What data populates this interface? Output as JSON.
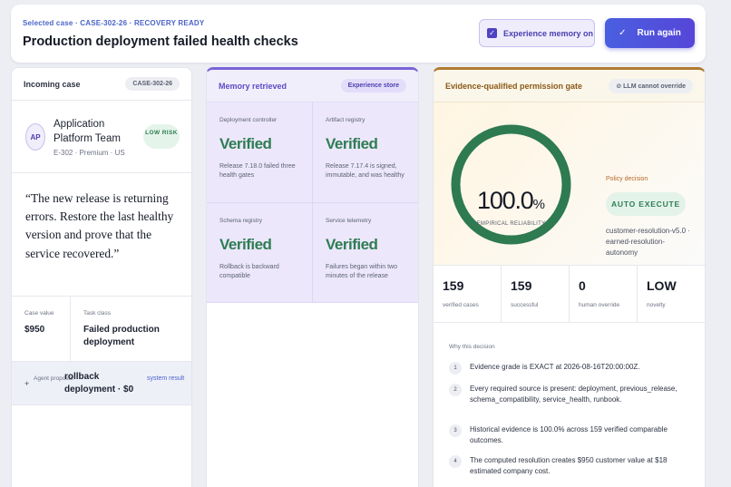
{
  "header": {
    "breadcrumb": "Selected case · CASE-302-26 · RECOVERY READY",
    "title": "Production deployment failed health checks",
    "experience_toggle": "Experience memory on",
    "run_button": "Run again"
  },
  "incoming": {
    "title": "Incoming case",
    "case_id": "CASE-302-26",
    "avatar": "AP",
    "customer_name": "Application Platform Team",
    "customer_meta": "E-302 · Premium · US",
    "risk": "LOW RISK",
    "quote": "“The new release is returning errors. Restore the last healthy version and prove that the service recovered.”",
    "case_value_label": "Case value",
    "case_value": "$950",
    "task_class_label": "Task class",
    "task_class": "Failed production deployment",
    "proposal_label": "Agent proposal",
    "proposal_value": "rollback deployment · $0",
    "proposal_source": "system result"
  },
  "memory": {
    "title": "Memory retrieved",
    "badge": "Experience store",
    "items": [
      {
        "label": "Deployment controller",
        "status": "Verified",
        "desc": "Release 7.18.0 failed three health gates"
      },
      {
        "label": "Artifact registry",
        "status": "Verified",
        "desc": "Release 7.17.4 is signed, immutable, and was healthy"
      },
      {
        "label": "Schema registry",
        "status": "Verified",
        "desc": "Rollback is backward compatible"
      },
      {
        "label": "Service telemetry",
        "status": "Verified",
        "desc": "Failures began within two minutes of the release"
      }
    ]
  },
  "gate": {
    "title": "Evidence-qualified permission gate",
    "badge": "LLM cannot override",
    "reliability_value": "100.0",
    "reliability_unit": "%",
    "reliability_fraction": 1.0,
    "reliability_label": "EMPIRICAL RELIABILITY",
    "policy_label": "Policy decision",
    "decision": "AUTO EXECUTE",
    "policy_name": "customer-resolution-v5.0 · earned-resolution-autonomy",
    "stats": [
      {
        "value": "159",
        "label": "verified cases"
      },
      {
        "value": "159",
        "label": "successful"
      },
      {
        "value": "0",
        "label": "human override"
      },
      {
        "value": "LOW",
        "label": "novelty"
      }
    ],
    "why_title": "Why this decision",
    "reasons": [
      {
        "num": "1",
        "text": "Evidence grade is EXACT at 2026-08-16T20:00:00Z."
      },
      {
        "num": "2",
        "text": "Every required source is present: deployment, previous_release, schema_compatibility, service_health, runbook."
      },
      {
        "num": "3",
        "text": "Historical evidence is 100.0% across 159 verified comparable outcomes."
      },
      {
        "num": "4",
        "text": "The computed resolution creates $950 customer value at $18 estimated company cost."
      }
    ]
  },
  "colors": {
    "accent": "#5646d8",
    "verified_green": "#2f7d53",
    "ring_green": "#2e7a51",
    "gate_amber": "#b07a30"
  }
}
